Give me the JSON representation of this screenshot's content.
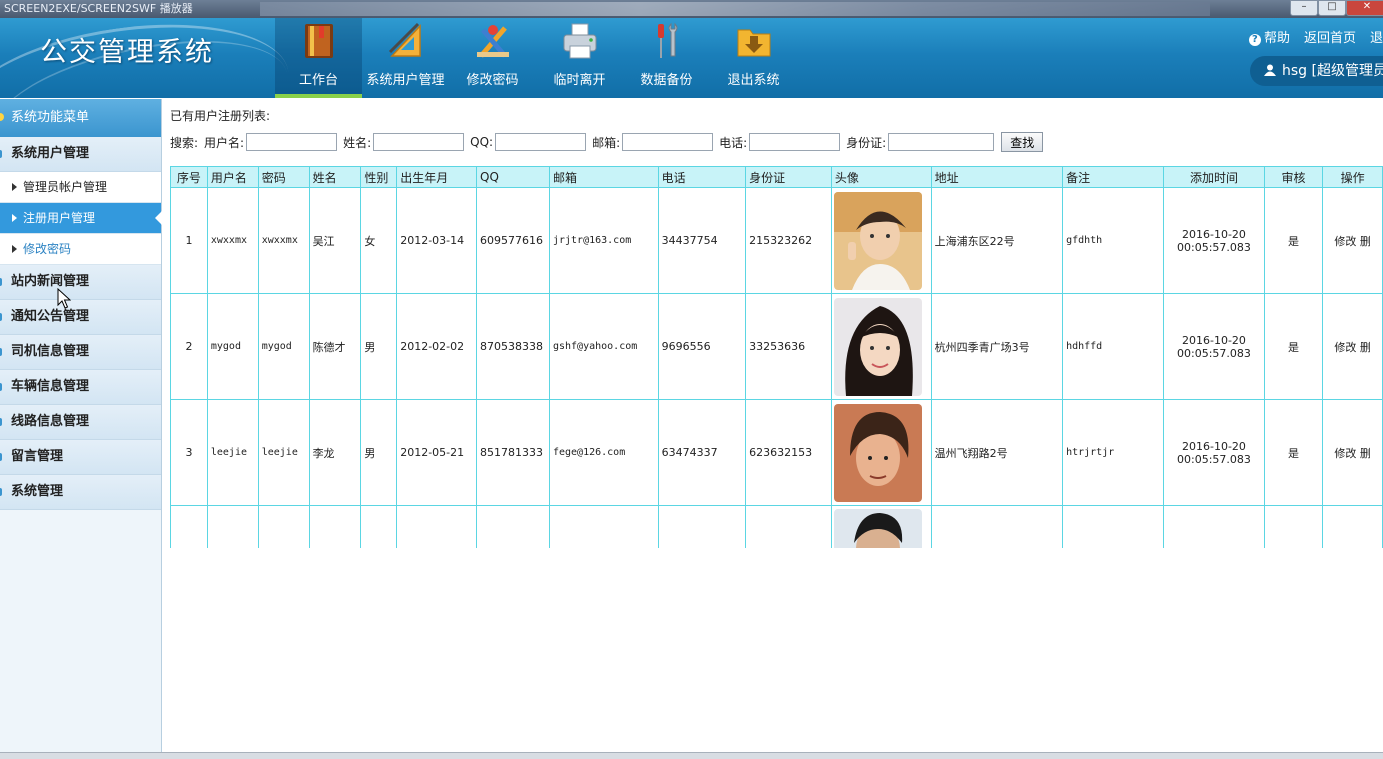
{
  "window": {
    "title": "SCREEN2EXE/SCREEN2SWF 播放器"
  },
  "app": {
    "title": "公交管理系统"
  },
  "nav": [
    {
      "label": "工作台",
      "icon": "book-icon",
      "active": true
    },
    {
      "label": "系统用户管理",
      "icon": "ruler-icon"
    },
    {
      "label": "修改密码",
      "icon": "tools-icon"
    },
    {
      "label": "临时离开",
      "icon": "printer-icon"
    },
    {
      "label": "数据备份",
      "icon": "screwdriver-icon"
    },
    {
      "label": "退出系统",
      "icon": "folder-icon"
    }
  ],
  "topright": {
    "help": "帮助",
    "home": "返回首页",
    "logout": "退"
  },
  "user": {
    "label": "hsg [超级管理员"
  },
  "sidebar": {
    "header": "系统功能菜单",
    "group_user": "系统用户管理",
    "sub1": "管理员帐户管理",
    "sub2": "注册用户管理",
    "sub3": "修改密码",
    "groups": [
      "站内新闻管理",
      "通知公告管理",
      "司机信息管理",
      "车辆信息管理",
      "线路信息管理",
      "留言管理",
      "系统管理"
    ]
  },
  "main": {
    "list_title": "已有用户注册列表:",
    "search": {
      "prefix": "搜索:",
      "username": "用户名:",
      "name": "姓名:",
      "qq": "QQ:",
      "email": "邮箱:",
      "phone": "电话:",
      "idcard": "身份证:",
      "button": "查找"
    }
  },
  "table": {
    "headers": [
      "序号",
      "用户名",
      "密码",
      "姓名",
      "性别",
      "出生年月",
      "QQ",
      "邮箱",
      "电话",
      "身份证",
      "头像",
      "地址",
      "备注",
      "添加时间",
      "审核",
      "操作"
    ],
    "rows": [
      {
        "no": "1",
        "username": "xwxxmx",
        "password": "xwxxmx",
        "name": "吴江",
        "gender": "女",
        "birth": "2012-03-14",
        "qq": "609577616",
        "email": "jrjtr@163.com",
        "phone": "34437754",
        "idcard": "215323262",
        "address": "上海浦东区22号",
        "note": "gfdhth",
        "added_date": "2016-10-20",
        "added_time": "00:05:57.083",
        "audit": "是",
        "ops": "修改 删"
      },
      {
        "no": "2",
        "username": "mygod",
        "password": "mygod",
        "name": "陈德才",
        "gender": "男",
        "birth": "2012-02-02",
        "qq": "870538338",
        "email": "gshf@yahoo.com",
        "phone": "9696556",
        "idcard": "33253636",
        "address": "杭州四季青广场3号",
        "note": "hdhffd",
        "added_date": "2016-10-20",
        "added_time": "00:05:57.083",
        "audit": "是",
        "ops": "修改 删"
      },
      {
        "no": "3",
        "username": "leejie",
        "password": "leejie",
        "name": "李龙",
        "gender": "男",
        "birth": "2012-05-21",
        "qq": "851781333",
        "email": "fege@126.com",
        "phone": "63474337",
        "idcard": "623632153",
        "address": "温州飞翔路2号",
        "note": "htrjrtjr",
        "added_date": "2016-10-20",
        "added_time": "00:05:57.083",
        "audit": "是",
        "ops": "修改 删"
      }
    ]
  }
}
